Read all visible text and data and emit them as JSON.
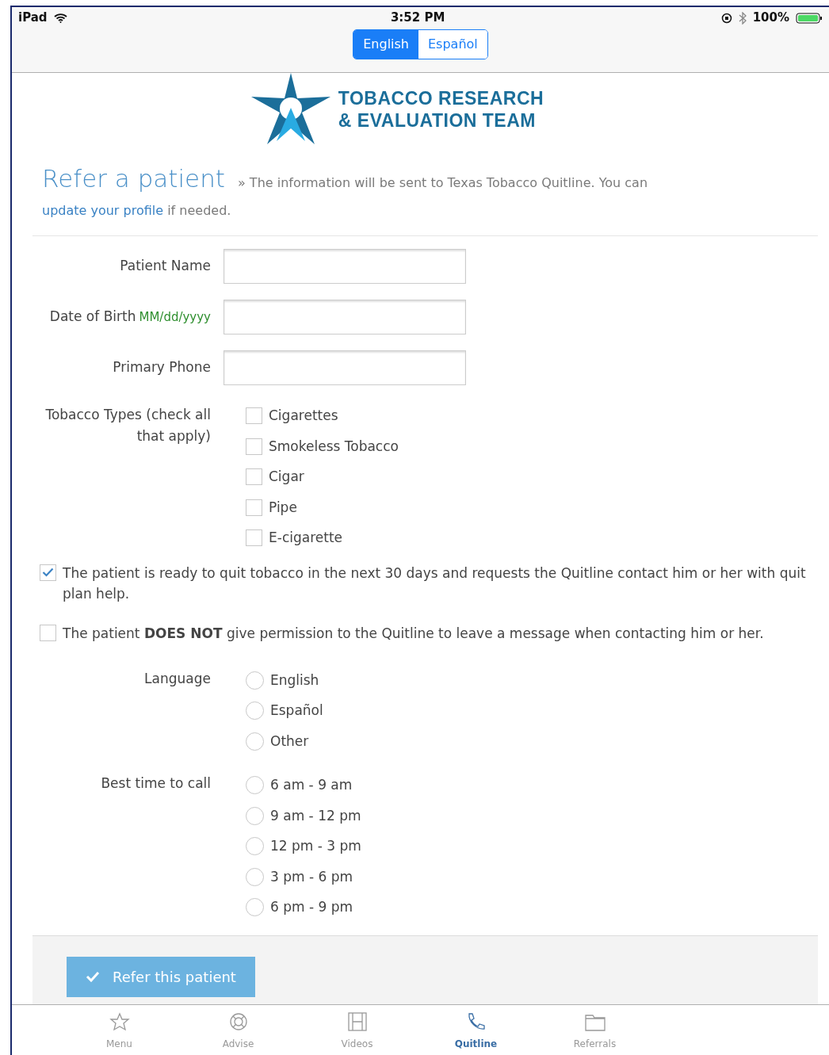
{
  "status_bar": {
    "device": "iPad",
    "time": "3:52 PM",
    "battery": "100%"
  },
  "language_toggle": [
    {
      "label": "English",
      "selected": true
    },
    {
      "label": "Español",
      "selected": false
    }
  ],
  "logo": {
    "line_1": "TOBACCO RESEARCH",
    "line_2": "& EVALUATION TEAM"
  },
  "header": {
    "title": "Refer a patient",
    "intro_before": "» The information will be sent to Texas Tobacco Quitline. You can",
    "link": "update your profile",
    "intro_after": "if needed."
  },
  "fields": [
    {
      "label": "Patient Name"
    },
    {
      "label": "Date of Birth",
      "format_hint": "MM/dd/yyyy"
    },
    {
      "label": "Primary Phone"
    }
  ],
  "tobacco_types": {
    "label": "Tobacco Types (check all that apply)",
    "options": [
      {
        "label": "Cigarettes",
        "checked": false
      },
      {
        "label": "Smokeless Tobacco",
        "checked": false
      },
      {
        "label": "Cigar",
        "checked": false
      },
      {
        "label": "Pipe",
        "checked": false
      },
      {
        "label": "E-cigarette",
        "checked": false
      }
    ]
  },
  "consents": [
    {
      "text": "The patient is ready to quit tobacco in the next 30 days and requests the Quitline contact him or her with quit plan help.",
      "checked": true
    },
    {
      "text": "The patient **DOES NOT** give permission to the Quitline to leave a message when contacting him or her.",
      "checked": false
    }
  ],
  "language": {
    "label": "Language",
    "options": [
      {
        "label": "English",
        "selected": false
      },
      {
        "label": "Español",
        "selected": false
      },
      {
        "label": "Other",
        "selected": false
      }
    ]
  },
  "best_time": {
    "label": "Best time to call",
    "options": [
      {
        "label": "6 am - 9 am",
        "selected": false
      },
      {
        "label": "9 am - 12 pm",
        "selected": false
      },
      {
        "label": "12 pm - 3 pm",
        "selected": false
      },
      {
        "label": "3 pm - 6 pm",
        "selected": false
      },
      {
        "label": "6 pm - 9 pm",
        "selected": false
      }
    ]
  },
  "submit_button": "Refer this patient",
  "tab_bar": [
    {
      "label": "Menu",
      "selected": false
    },
    {
      "label": "Advise",
      "selected": false
    },
    {
      "label": "Videos",
      "selected": false
    },
    {
      "label": "Quitline",
      "selected": true
    },
    {
      "label": "Referrals",
      "selected": false
    }
  ]
}
